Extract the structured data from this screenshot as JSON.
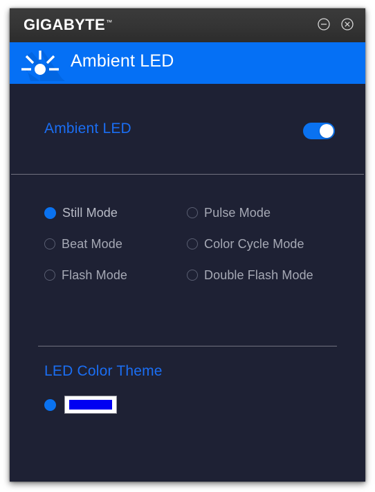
{
  "window": {
    "brand": "GIGABYTE",
    "brand_trademark": "™",
    "titlebar_bg": "#343434",
    "body_bg": "#1e2134",
    "accent": "#0570f5",
    "controls": [
      {
        "name": "minimize",
        "label": "Minimize",
        "glyph": "circle-minus"
      },
      {
        "name": "close",
        "label": "Close",
        "glyph": "circle-x"
      }
    ]
  },
  "header": {
    "title": "Ambient LED",
    "icon": "ambient-led-sun-icon",
    "bg": "#0570f5",
    "text_color": "#ffffff"
  },
  "ambient": {
    "label": "Ambient LED",
    "label_color": "#1b6ef3",
    "toggle": {
      "state": "on",
      "on_color": "#0a72f0",
      "knob_color": "#ffffff"
    }
  },
  "modes": {
    "selected": "Still Mode",
    "selected_color": "#0a72f0",
    "left": [
      {
        "label": "Still Mode",
        "selected": true
      },
      {
        "label": "Beat Mode",
        "selected": false
      },
      {
        "label": "Flash Mode",
        "selected": false
      }
    ],
    "right": [
      {
        "label": "Pulse Mode",
        "selected": false
      },
      {
        "label": "Color Cycle Mode",
        "selected": false
      },
      {
        "label": "Double Flash Mode",
        "selected": false
      }
    ]
  },
  "color_theme": {
    "title": "LED Color Theme",
    "title_color": "#1b6ef3",
    "selected": true,
    "swatch_color": "#0000f2",
    "swatch_border": "#ffffff"
  }
}
